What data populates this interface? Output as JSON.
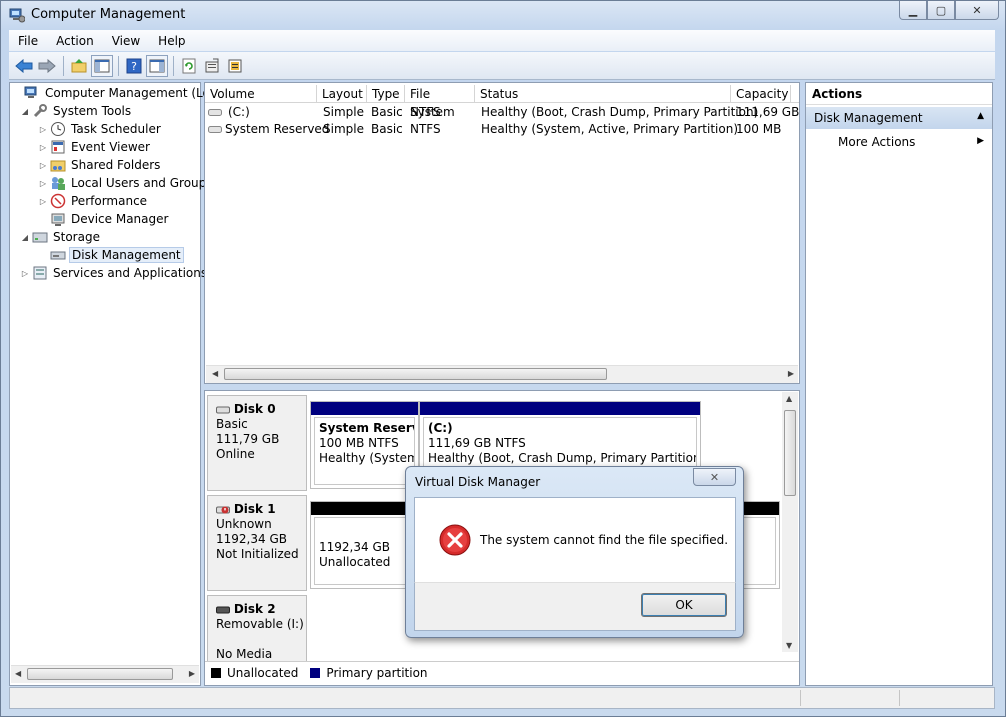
{
  "window": {
    "title": "Computer Management"
  },
  "menu": [
    "File",
    "Action",
    "View",
    "Help"
  ],
  "tree": {
    "root": "Computer Management (Local",
    "system_tools": "System Tools",
    "task_scheduler": "Task Scheduler",
    "event_viewer": "Event Viewer",
    "shared_folders": "Shared Folders",
    "local_users": "Local Users and Groups",
    "performance": "Performance",
    "device_manager": "Device Manager",
    "storage": "Storage",
    "disk_management": "Disk Management",
    "services": "Services and Applications"
  },
  "volume_list": {
    "columns": [
      "Volume",
      "Layout",
      "Type",
      "File System",
      "Status",
      "Capacity"
    ],
    "rows": [
      [
        "(C:)",
        "Simple",
        "Basic",
        "NTFS",
        "Healthy (Boot, Crash Dump, Primary Partition)",
        "111,69 GB"
      ],
      [
        "System Reserved",
        "Simple",
        "Basic",
        "NTFS",
        "Healthy (System, Active, Primary Partition)",
        "100 MB"
      ]
    ]
  },
  "disks": {
    "disk0": {
      "name": "Disk 0",
      "type": "Basic",
      "size": "111,79 GB",
      "status": "Online",
      "p1": {
        "name": "System Reservec",
        "size": "100 MB NTFS",
        "status": "Healthy (System, A"
      },
      "p2": {
        "name": "(C:)",
        "size": "111,69 GB NTFS",
        "status": "Healthy (Boot, Crash Dump, Primary Partition)"
      }
    },
    "disk1": {
      "name": "Disk 1",
      "type": "Unknown",
      "size": "1192,34 GB",
      "status": "Not Initialized",
      "p1": {
        "size": "1192,34 GB",
        "status": "Unallocated"
      }
    },
    "disk2": {
      "name": "Disk 2",
      "type": "Removable (I:)",
      "status": "No Media"
    }
  },
  "legend": {
    "unallocated": "Unallocated",
    "primary": "Primary partition"
  },
  "colors": {
    "primary_partition": "#00007f",
    "unallocated": "#000000"
  },
  "actions": {
    "title": "Actions",
    "section": "Disk Management",
    "more": "More Actions"
  },
  "dialog": {
    "title": "Virtual Disk Manager",
    "message": "The system cannot find the file specified.",
    "ok": "OK"
  }
}
